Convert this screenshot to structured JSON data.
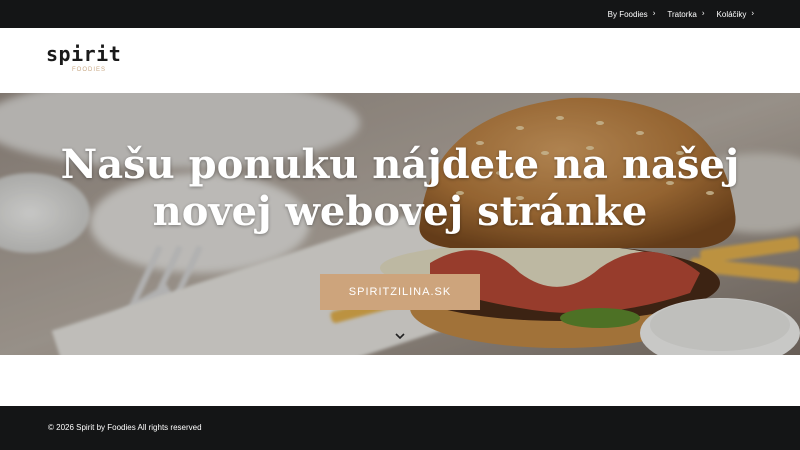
{
  "topnav": {
    "items": [
      {
        "label": "By Foodies",
        "icon": "chevron-right-icon"
      },
      {
        "label": "Tratorka",
        "icon": "chevron-right-icon"
      },
      {
        "label": "Koláčiky",
        "icon": "chevron-right-icon"
      }
    ]
  },
  "header": {
    "logo_word": "spirit",
    "logo_sub": "FOODIES"
  },
  "hero": {
    "title_line1": "Našu ponuku nájdete na našej",
    "title_line2": "novej webovej stránke",
    "cta_label": "SPIRITZILINA.SK",
    "scroll_icon": "chevron-down-icon"
  },
  "footer": {
    "text": "© 2026 Spirit by Foodies All rights reserved"
  },
  "colors": {
    "dark_bar": "#141516",
    "accent": "#cda47c",
    "logo_sub": "#c9a985"
  }
}
